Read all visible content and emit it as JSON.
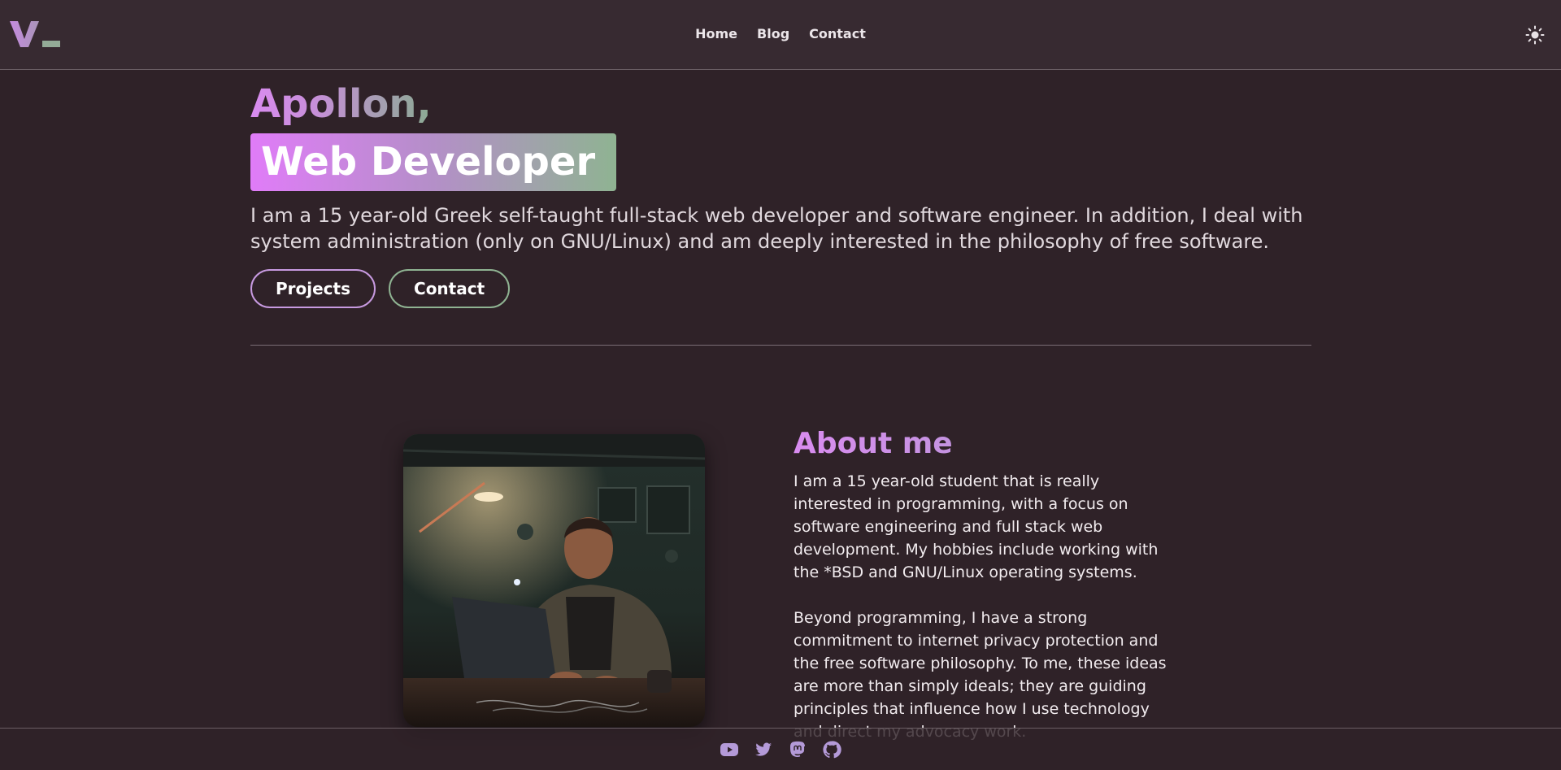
{
  "header": {
    "logo": "V_",
    "nav": [
      {
        "label": "Home"
      },
      {
        "label": "Blog"
      },
      {
        "label": "Contact"
      }
    ],
    "theme_toggle_icon": "sun-icon"
  },
  "hero": {
    "name": "Apollon,",
    "role": "Web Developer",
    "intro": "I am a 15 year-old Greek self-taught full-stack web developer and software engineer. In addition, I deal with system administration (only on GNU/Linux) and am deeply interested in the philosophy of free software.",
    "buttons": {
      "projects": "Projects",
      "contact": "Contact"
    }
  },
  "about": {
    "title": "About me",
    "paragraphs": [
      "I am a 15 year-old student that is really interested in programming, with a focus on software engineering and full stack web development. My hobbies include working with the *BSD and GNU/Linux operating systems.",
      "Beyond programming, I have a strong commitment to internet privacy protection and the free software philosophy. To me, these ideas are more than simply ideals; they are guiding principles that influence how I use technology and direct my advocacy work."
    ]
  },
  "footer": {
    "socials": [
      "youtube-icon",
      "twitter-icon",
      "mastodon-icon",
      "github-icon"
    ]
  },
  "colors": {
    "background": "#2f2228",
    "header": "#372a31",
    "accent_purple": "#d98cf0",
    "accent_green": "#8fb392",
    "social_icons": "#b49ad8"
  }
}
